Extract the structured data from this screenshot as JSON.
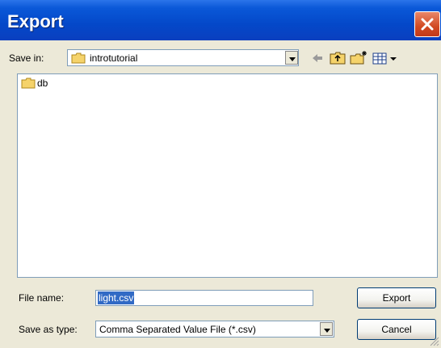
{
  "window": {
    "title": "Export",
    "close_icon": "close-icon"
  },
  "save_in": {
    "label": "Save in:",
    "value": "introtutorial"
  },
  "toolbar": {
    "icons": [
      "back-arrow-icon",
      "up-folder-icon",
      "new-folder-icon",
      "view-menu-icon"
    ]
  },
  "files": [
    {
      "name": "db",
      "icon": "folder-icon"
    }
  ],
  "file_name": {
    "label": "File name:",
    "value": "light.csv"
  },
  "save_as_type": {
    "label": "Save as type:",
    "value": "Comma Separated Value File (*.csv)"
  },
  "buttons": {
    "export": "Export",
    "cancel": "Cancel"
  },
  "colors": {
    "titlebar": "#0a58d8",
    "dialog_bg": "#ece9d8",
    "close": "#d24a22",
    "selection": "#316ac5"
  }
}
